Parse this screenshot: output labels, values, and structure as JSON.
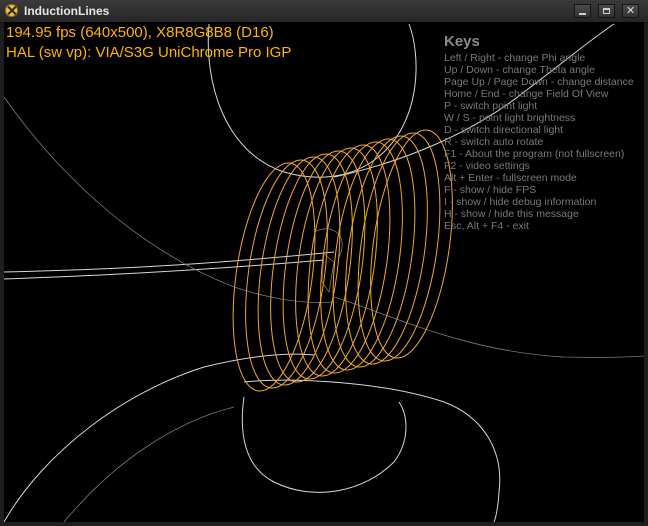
{
  "window": {
    "title": "InductionLines",
    "icon": "app-x-icon",
    "controls": {
      "minimize": "minimize-icon",
      "maximize": "maximize-icon",
      "close_glyph": "✕"
    }
  },
  "overlay": {
    "fps_line": "194.95 fps (640x500), X8R8G8B8 (D16)",
    "device_line": "HAL (sw vp): VIA/S3G UniChrome Pro IGP",
    "color": "#ffb400"
  },
  "keys": {
    "title": "Keys",
    "items": [
      "Left / Right - change Phi angle",
      "Up / Down - change Theta angle",
      "Page Up / Page Down - change distance",
      "Home / End - change Field Of View",
      "P - switch point light",
      "W / S - point light brightness",
      "D - switch directional light",
      "R - switch auto rotate",
      "F1 - About the program (not fullscreen)",
      "F2 - video settings",
      "Alt + Enter - fullscreen mode",
      "F - show / hide FPS",
      "I - show / hide debug information",
      "H - show / hide this message",
      "Esc, Alt + F4 - exit"
    ]
  },
  "scene": {
    "coil_color": "#f0a830",
    "field_line_color": "#cfcfcf",
    "background": "#000000"
  }
}
